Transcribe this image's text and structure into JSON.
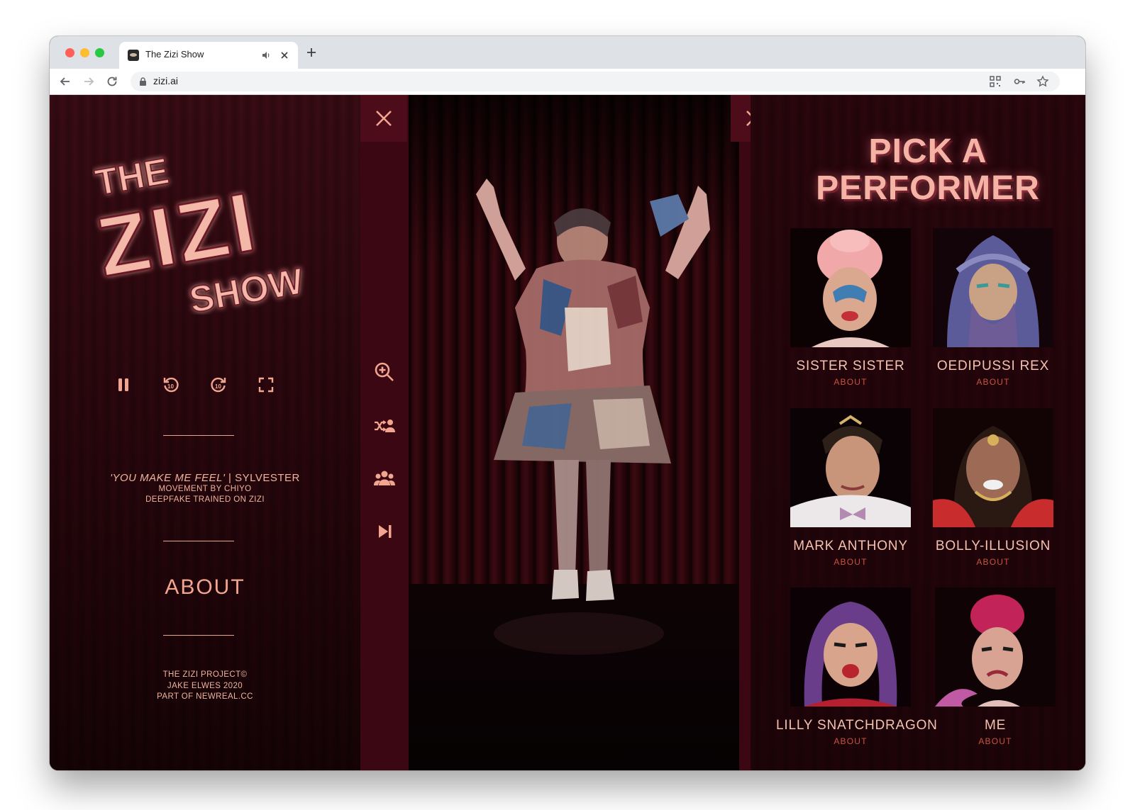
{
  "browser": {
    "tab_title": "The Zizi Show",
    "url": "zizi.ai"
  },
  "logo": {
    "line1": "THE",
    "line2": "ZIZI",
    "line3": "SHOW"
  },
  "player": {
    "controls": [
      "pause-icon",
      "rewind-10-icon",
      "forward-10-icon",
      "fullscreen-icon"
    ],
    "song_title": "'YOU MAKE ME FEEL'",
    "song_artist": " | SYLVESTER",
    "credit_movement": "MOVEMENT BY CHIYO",
    "credit_deepfake": "DEEPFAKE TRAINED ON ZIZI"
  },
  "about_link": "ABOUT",
  "footer": {
    "line1": "THE ZIZI PROJECT©",
    "line2": "JAKE ELWES 2020",
    "line3": "PART OF NEWREAL.CC"
  },
  "side_tools": [
    "zoom-in-icon",
    "shuffle-performer-icon",
    "group-icon",
    "skip-next-icon"
  ],
  "picker": {
    "title_line1": "PICK A",
    "title_line2": "PERFORMER",
    "about_label": "ABOUT",
    "performers": [
      {
        "name": "SISTER SISTER"
      },
      {
        "name": "OEDIPUSSI REX"
      },
      {
        "name": "MARK ANTHONY"
      },
      {
        "name": "BOLLY-ILLUSION"
      },
      {
        "name": "LILLY SNATCHDRAGON"
      },
      {
        "name": "ME"
      }
    ]
  },
  "colors": {
    "accent": "#f2a58f",
    "panel": "#2b070e",
    "strip": "#3b0712"
  }
}
